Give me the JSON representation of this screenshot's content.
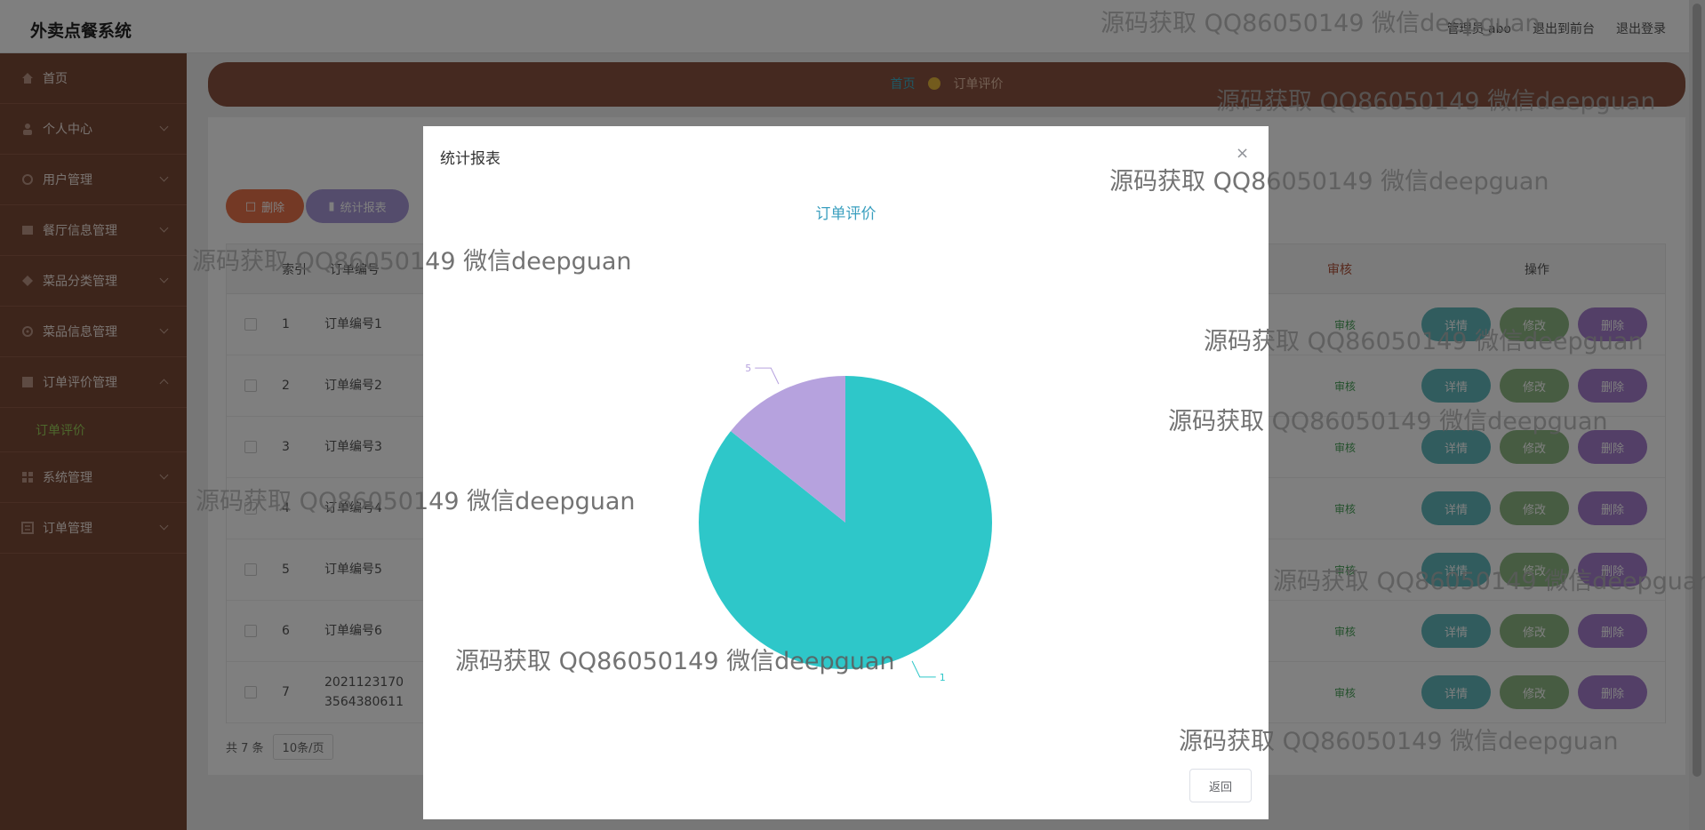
{
  "app": {
    "brand": "外卖点餐系统"
  },
  "topbar": {
    "user": "管理员 abo",
    "front": "退出到前台",
    "logout": "退出登录"
  },
  "sidebar": {
    "items": [
      {
        "label": "首页",
        "icon": "home-icon"
      },
      {
        "label": "个人中心",
        "icon": "user-icon"
      },
      {
        "label": "用户管理",
        "icon": "users-icon"
      },
      {
        "label": "餐厅信息管理",
        "icon": "restaurant-icon"
      },
      {
        "label": "菜品分类管理",
        "icon": "category-icon"
      },
      {
        "label": "菜品信息管理",
        "icon": "dish-icon"
      },
      {
        "label": "订单评价管理",
        "icon": "review-icon"
      }
    ],
    "sub_item": "订单评价",
    "bottom_items": [
      {
        "label": "系统管理",
        "icon": "system-icon"
      },
      {
        "label": "订单管理",
        "icon": "order-icon"
      }
    ]
  },
  "breadcrumb": {
    "home": "首页",
    "current": "订单评价"
  },
  "toolbar": {
    "delete": "删除",
    "report": "统计报表"
  },
  "table": {
    "headers": {
      "index": "索引",
      "order_no": "订单编号",
      "audit": "审核",
      "actions": "操作"
    },
    "audit_label": "审核",
    "detail_label": "详情",
    "edit_label": "修改",
    "delete_label": "删除",
    "rows": [
      {
        "index": "1",
        "order_no": "订单编号1"
      },
      {
        "index": "2",
        "order_no": "订单编号2"
      },
      {
        "index": "3",
        "order_no": "订单编号3"
      },
      {
        "index": "4",
        "order_no": "订单编号4"
      },
      {
        "index": "5",
        "order_no": "订单编号5"
      },
      {
        "index": "6",
        "order_no": "订单编号6"
      },
      {
        "index": "7",
        "order_no": "2021123170 3564380611"
      }
    ]
  },
  "pager": {
    "total": "共 7 条",
    "page_size": "10条/页"
  },
  "modal": {
    "title": "统计报表",
    "close": "×",
    "back": "返回"
  },
  "chart_data": {
    "type": "pie",
    "title": "订单评价",
    "slices": [
      {
        "label": "1",
        "value": 30,
        "color": "#2ec7c9"
      },
      {
        "label": "5",
        "value": 5,
        "color": "#b6a2de"
      }
    ]
  },
  "watermark": "源码获取 QQ86050149 微信deepguan"
}
